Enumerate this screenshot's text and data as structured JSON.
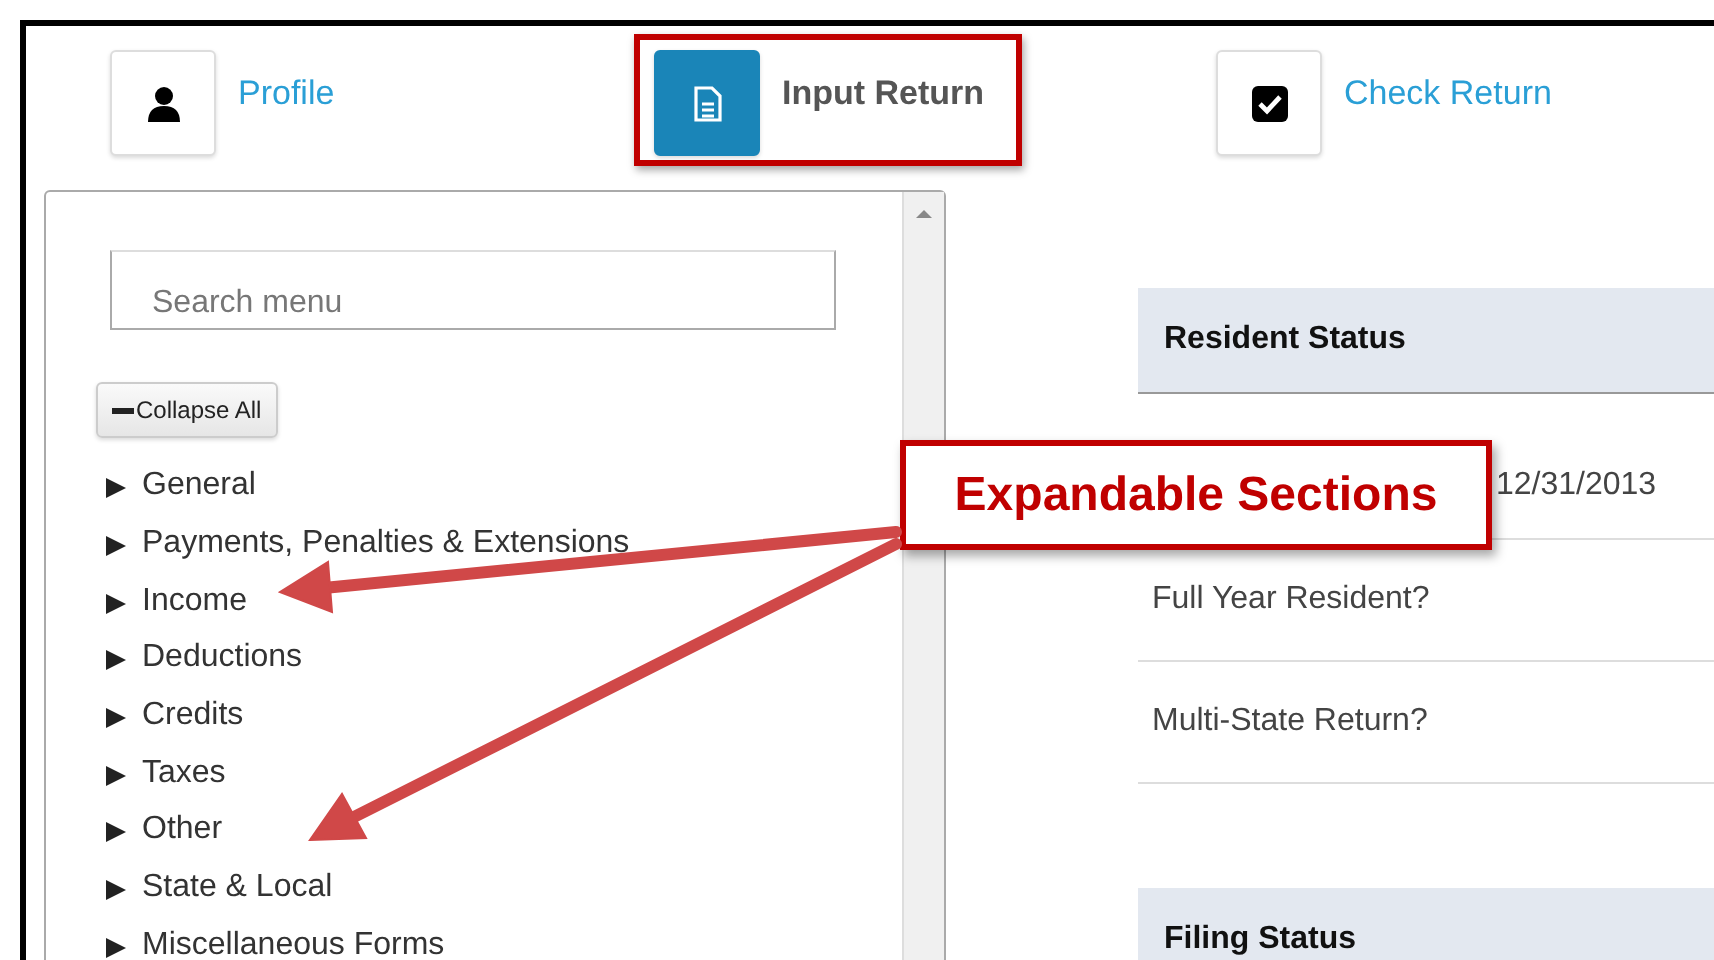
{
  "nav": [
    {
      "label": "Profile",
      "kind": "person",
      "selected": false,
      "highlighted": false
    },
    {
      "label": "Input Return",
      "kind": "document",
      "selected": true,
      "highlighted": true
    },
    {
      "label": "Check Return",
      "kind": "checkbox",
      "selected": false,
      "highlighted": false
    }
  ],
  "sidebar": {
    "search": {
      "placeholder": "Search menu"
    },
    "collapse_button": "Collapse All",
    "items": [
      {
        "label": "General",
        "expanded": false
      },
      {
        "label": "Payments, Penalties & Extensions",
        "expanded": false
      },
      {
        "label": "Income",
        "expanded": false
      },
      {
        "label": "Deductions",
        "expanded": false
      },
      {
        "label": "Credits",
        "expanded": false
      },
      {
        "label": "Taxes",
        "expanded": false
      },
      {
        "label": "Other",
        "expanded": false
      },
      {
        "label": "State & Local",
        "expanded": false
      },
      {
        "label": "Miscellaneous Forms",
        "expanded": false
      }
    ]
  },
  "sections": [
    {
      "title": "Resident Status",
      "rows": [
        {
          "value": "12/31/2013"
        },
        {
          "label": "Full Year Resident?"
        },
        {
          "label": "Multi-State Return?"
        }
      ]
    },
    {
      "title": "Filing Status"
    }
  ],
  "callout": {
    "text": "Expandable Sections"
  }
}
